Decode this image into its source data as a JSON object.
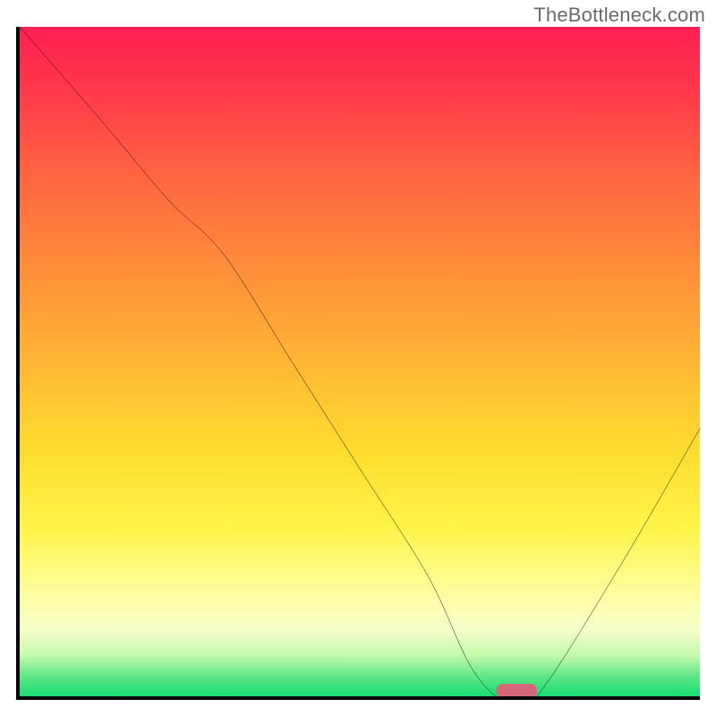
{
  "watermark": "TheBottleneck.com",
  "colors": {
    "axis": "#000000",
    "curve": "#000000",
    "marker": "#d6677a",
    "gradient_top": "#ff1f52",
    "gradient_bottom": "#18dc74"
  },
  "chart_data": {
    "type": "line",
    "title": "",
    "xlabel": "",
    "ylabel": "",
    "xlim": [
      0,
      100
    ],
    "ylim": [
      0,
      100
    ],
    "grid": false,
    "legend": false,
    "series": [
      {
        "name": "bottleneck-curve",
        "x": [
          0,
          12,
          22,
          30,
          40,
          50,
          60,
          66,
          70,
          72,
          76,
          88,
          100
        ],
        "y": [
          100,
          86,
          74,
          66,
          50,
          34,
          18,
          5,
          0,
          0,
          0,
          19,
          40
        ]
      }
    ],
    "annotations": [
      {
        "name": "optimum-marker",
        "x": 73,
        "y": 0,
        "shape": "pill"
      }
    ],
    "background": "vertical-gradient red→yellow→green (red=high bottleneck, green=low)"
  }
}
